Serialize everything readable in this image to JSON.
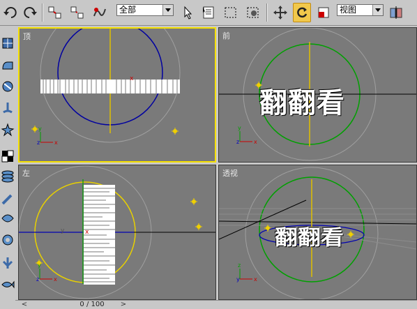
{
  "toolbar": {
    "selection_filter": "全部",
    "reference_coord": "视图"
  },
  "viewports": {
    "top": {
      "label": "顶"
    },
    "front": {
      "label": "前"
    },
    "left": {
      "label": "左"
    },
    "perspective": {
      "label": "透视"
    }
  },
  "logo_text": "翻翻看",
  "timeline": {
    "frame_counter": "0 / 100"
  },
  "icons": [
    "undo-icon",
    "redo-icon",
    "select-link-icon",
    "unlink-icon",
    "bind-space-warp-icon",
    "select-object-icon",
    "select-by-name-icon",
    "rect-selection-icon",
    "window-crossing-icon",
    "move-icon",
    "rotate-icon",
    "scale-icon",
    "pivot-center-icon",
    "create-geometry-icon",
    "create-shapes-icon",
    "create-lights-icon",
    "create-cameras-icon",
    "create-helpers-icon",
    "modify-icon",
    "hierarchy-icon",
    "motion-icon",
    "display-icon",
    "utilities-icon"
  ],
  "colors": {
    "active_viewport_border": "#f5e000",
    "circle_top": "#0000a0",
    "circle_front": "#00a000",
    "circle_left": "#e8d000",
    "grid_axis": "#000000"
  }
}
